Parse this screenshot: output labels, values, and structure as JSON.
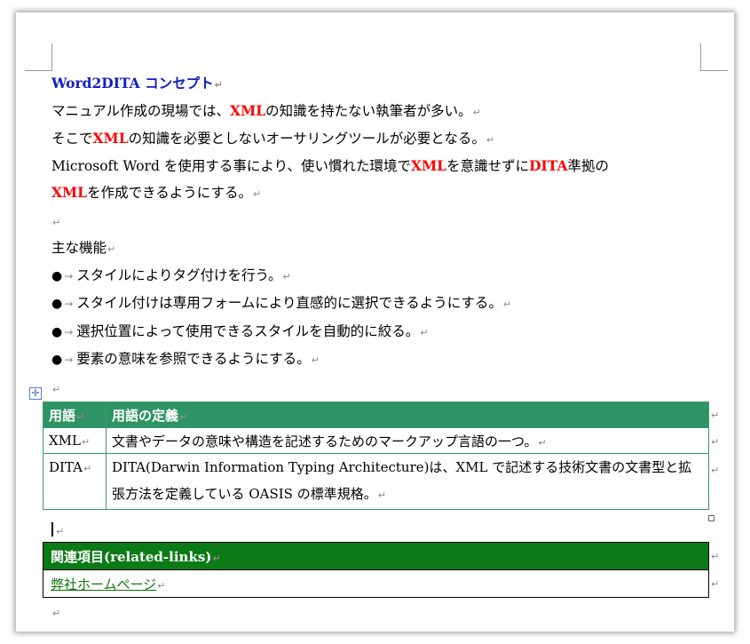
{
  "doc": {
    "title": "Word2DITA コンセプト",
    "para1": {
      "a": "マニュアル作成の現場では、",
      "b": "XML",
      "c": "の知識を持たない執筆者が多い。"
    },
    "para2": {
      "a": "そこで",
      "b": "XML",
      "c": "の知識を必要としないオーサリングツールが必要となる。"
    },
    "para3": {
      "a": "Microsoft Word を使用する事により、使い慣れた環境で",
      "b": "XML",
      "c": "を意識せずに",
      "d": "DITA",
      "e": "準拠の"
    },
    "para4": {
      "a": "XML",
      "b": "を作成できるようにする。"
    },
    "features_heading": "主な機能",
    "bullets": [
      "スタイルによりタグ付けを行う。",
      "スタイル付けは専用フォームにより直感的に選択できるようにする。",
      "選択位置によって使用できるスタイルを自動的に絞る。",
      "要素の意味を参照できるようにする。"
    ],
    "para_mark": "↵",
    "bullet_dot": "●",
    "bullet_arrow": "→"
  },
  "terms_table": {
    "headers": [
      "用語",
      "用語の定義"
    ],
    "rows": [
      [
        "XML",
        "文書やデータの意味や構造を記述するためのマークアップ言語の一つ。"
      ],
      [
        "DITA",
        "DITA(Darwin Information Typing Architecture)は、XML で記述する技術文書の文書型と拡張方法を定義している OASIS の標準規格。"
      ]
    ]
  },
  "related_table": {
    "header": "関連項目(related-links)",
    "link": "弊社ホームページ"
  },
  "colors": {
    "title": "#1020c0",
    "emphasis": "#ff0000",
    "table_header": "#2e9466",
    "related_header": "#0b7a17",
    "link": "#117711"
  }
}
